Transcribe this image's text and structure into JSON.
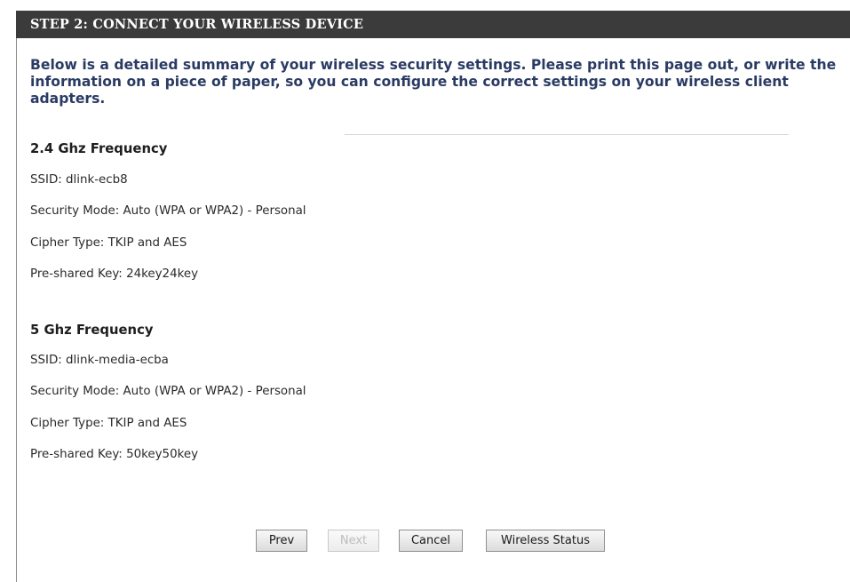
{
  "header": {
    "title": "STEP 2: CONNECT YOUR WIRELESS DEVICE"
  },
  "intro": "Below is a detailed summary of your wireless security settings. Please print this page out, or write the information on a piece of paper, so you can configure the correct settings on your wireless client adapters.",
  "band_24": {
    "heading": "2.4 Ghz Frequency",
    "ssid": "SSID: dlink-ecb8",
    "security_mode": "Security Mode: Auto (WPA or WPA2) - Personal",
    "cipher_type": "Cipher Type: TKIP and AES",
    "psk": "Pre-shared Key: 24key24key"
  },
  "band_5": {
    "heading": "5 Ghz Frequency",
    "ssid": "SSID: dlink-media-ecba",
    "security_mode": "Security Mode: Auto (WPA or WPA2) - Personal",
    "cipher_type": "Cipher Type: TKIP and AES",
    "psk": "Pre-shared Key: 50key50key"
  },
  "buttons": {
    "prev": "Prev",
    "next": "Next",
    "cancel": "Cancel",
    "wireless_status": "Wireless Status"
  }
}
